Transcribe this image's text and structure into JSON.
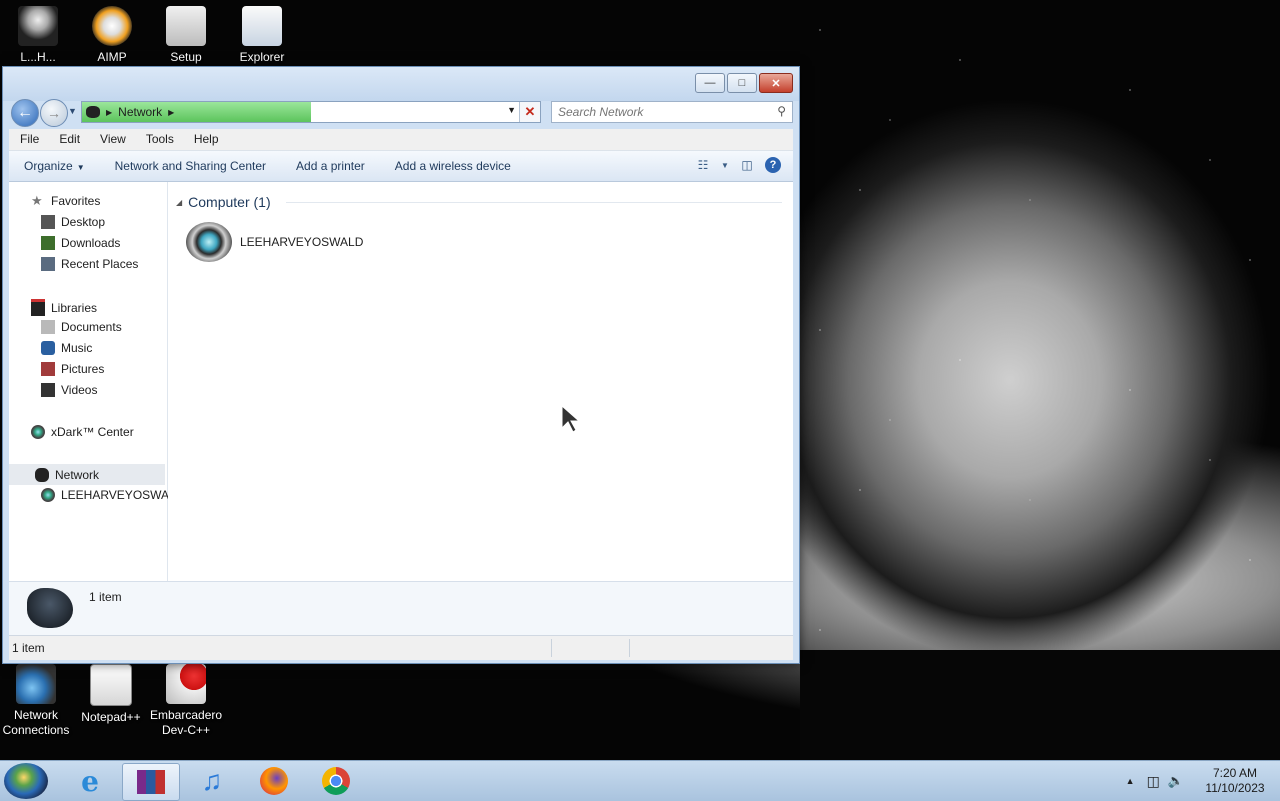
{
  "desktop": {
    "top_icons": [
      {
        "name": "user-folder-icon",
        "label": "L...H..."
      },
      {
        "name": "aimp-icon",
        "label": "AIMP"
      },
      {
        "name": "setup-icon",
        "label": "Setup"
      },
      {
        "name": "explorer-icon",
        "label": "Explorer"
      }
    ],
    "bottom_icons": [
      {
        "name": "network-connections-icon",
        "label": "Network Connections"
      },
      {
        "name": "notepadpp-icon",
        "label": "Notepad++"
      },
      {
        "name": "devcpp-icon",
        "label": "Embarcadero Dev-C++"
      }
    ]
  },
  "window": {
    "address": {
      "crumbs": [
        "Network"
      ],
      "load_progress": 0.5
    },
    "search": {
      "placeholder": "Search Network"
    },
    "menu": [
      "File",
      "Edit",
      "View",
      "Tools",
      "Help"
    ],
    "commands": {
      "organize": "Organize",
      "sharing": "Network and Sharing Center",
      "printer": "Add a printer",
      "wireless": "Add a wireless device"
    },
    "nav": {
      "favorites": "Favorites",
      "desktop": "Desktop",
      "downloads": "Downloads",
      "recent": "Recent Places",
      "libraries": "Libraries",
      "documents": "Documents",
      "music": "Music",
      "pictures": "Pictures",
      "videos": "Videos",
      "xdark": "xDark™ Center",
      "network": "Network",
      "computer": "LEEHARVEYOSWALD"
    },
    "content": {
      "group_header": "Computer (1)",
      "items": [
        {
          "label": "LEEHARVEYOSWALD"
        }
      ]
    },
    "details": {
      "count": "1 item"
    },
    "status": {
      "text": "1 item"
    }
  },
  "taskbar": {
    "clock_time": "7:20 AM",
    "clock_date": "11/10/2023",
    "apps": [
      "internet-explorer-icon",
      "winrar-icon",
      "itunes-icon",
      "firefox-icon",
      "chrome-icon"
    ]
  }
}
